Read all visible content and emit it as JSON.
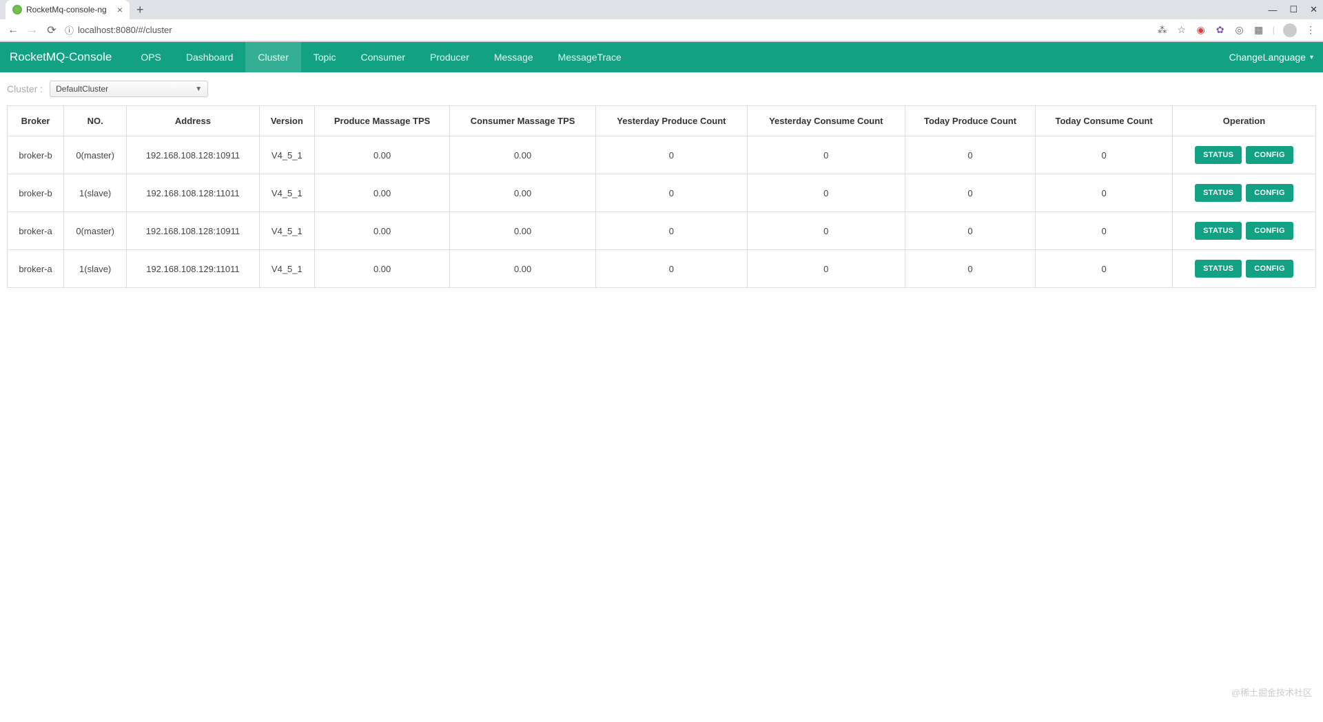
{
  "browser": {
    "tab_title": "RocketMq-console-ng",
    "url": "localhost:8080/#/cluster"
  },
  "navbar": {
    "brand": "RocketMQ-Console",
    "items": [
      "OPS",
      "Dashboard",
      "Cluster",
      "Topic",
      "Consumer",
      "Producer",
      "Message",
      "MessageTrace"
    ],
    "active_index": 2,
    "language_label": "ChangeLanguage"
  },
  "filter": {
    "label": "Cluster :",
    "selected": "DefaultCluster"
  },
  "table": {
    "headers": [
      "Broker",
      "NO.",
      "Address",
      "Version",
      "Produce Massage TPS",
      "Consumer Massage TPS",
      "Yesterday Produce Count",
      "Yesterday Consume Count",
      "Today Produce Count",
      "Today Consume Count",
      "Operation"
    ],
    "rows": [
      {
        "broker": "broker-b",
        "no": "0(master)",
        "address": "192.168.108.128:10911",
        "version": "V4_5_1",
        "ptps": "0.00",
        "ctps": "0.00",
        "ypc": "0",
        "ycc": "0",
        "tpc": "0",
        "tcc": "0"
      },
      {
        "broker": "broker-b",
        "no": "1(slave)",
        "address": "192.168.108.128:11011",
        "version": "V4_5_1",
        "ptps": "0.00",
        "ctps": "0.00",
        "ypc": "0",
        "ycc": "0",
        "tpc": "0",
        "tcc": "0"
      },
      {
        "broker": "broker-a",
        "no": "0(master)",
        "address": "192.168.108.128:10911",
        "version": "V4_5_1",
        "ptps": "0.00",
        "ctps": "0.00",
        "ypc": "0",
        "ycc": "0",
        "tpc": "0",
        "tcc": "0"
      },
      {
        "broker": "broker-a",
        "no": "1(slave)",
        "address": "192.168.108.129:11011",
        "version": "V4_5_1",
        "ptps": "0.00",
        "ctps": "0.00",
        "ypc": "0",
        "ycc": "0",
        "tpc": "0",
        "tcc": "0"
      }
    ],
    "buttons": {
      "status": "STATUS",
      "config": "CONFIG"
    }
  },
  "watermark": "@稀土掘金技术社区"
}
